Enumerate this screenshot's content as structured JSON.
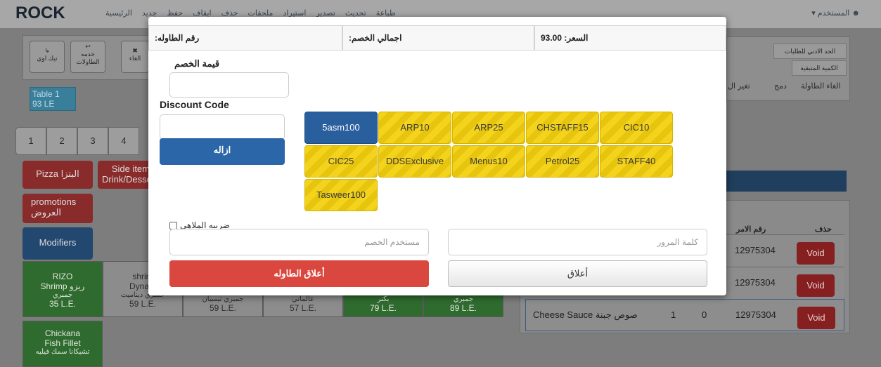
{
  "topbar": {
    "brand": "ROCK",
    "menu": [
      "الرئيسية",
      "جديد",
      "حفظ",
      "ايقاف",
      "حذف",
      "ملحقات",
      "استيراد",
      "تصدير",
      "تحديث",
      "طباعة"
    ],
    "user": "المستخدم"
  },
  "background": {
    "action_buttons": [
      "تيك اوي",
      "خدمه الطاولات",
      "الغاء"
    ],
    "table_card": {
      "name": "Table 1",
      "amount": "93 LE"
    },
    "tabs": [
      "1",
      "2",
      "3",
      "4"
    ],
    "categories": [
      "Pizza البتزا",
      "Side item Drink/Desse",
      "promotions العروض",
      "Modifiers"
    ],
    "right_labels": [
      "الحد الادني للطلبات",
      "الكمية المتبقية"
    ],
    "right_actions": [
      "الغاء الطاولة",
      "دمج",
      "تغير ال"
    ],
    "order_header": {
      "delete": "حذف",
      "order_no": "رقم الامر"
    },
    "orders": [
      {
        "name": "",
        "qty": "",
        "disc": "",
        "no": "12975304",
        "void": "Void"
      },
      {
        "name": "",
        "qty": "",
        "disc": "",
        "no": "12975304",
        "void": "Void"
      },
      {
        "name": "Cheese Sauce صوص جبنة",
        "qty": "1",
        "disc": "0",
        "no": "12975304",
        "void": "Void"
      }
    ],
    "products": [
      {
        "line1": "RIZO",
        "line2": "Shrimp ريزو",
        "line3": "جمبري",
        "price": "35 L.E."
      },
      {
        "line1": "shrim",
        "line2": "Dynam",
        "line3": "جمبري ديناميت",
        "price": "59 L.E."
      },
      {
        "line1": "",
        "line2": "",
        "line3": "جمبري تيمبيان",
        "price": "59 L.E."
      },
      {
        "line1": "",
        "line2": "",
        "line3": "عالماتي",
        "price": "57 L.E."
      },
      {
        "line1": "",
        "line2": "",
        "line3": "بكتر",
        "price": "79 L.E."
      },
      {
        "line1": "",
        "line2": "",
        "line3": "جمبري",
        "price": "89 L.E."
      },
      {
        "line1": "Chickana",
        "line2": "Fish Fillet",
        "line3": "تشيكانا سمك فيليه",
        "price": ""
      }
    ]
  },
  "modal": {
    "header": {
      "table_no": ":رقم الطاوله",
      "total_discount": ":اجمالي الخصم",
      "price": "93.00 :السعر"
    },
    "discount_value_label": "قيمة الخصم",
    "discount_code_label": "Discount Code",
    "remove_button": "ازاله",
    "codes": [
      "5asm100",
      "ARP10",
      "ARP25",
      "CHSTAFF15",
      "CIC10",
      "CIC25",
      "DDSExclusive",
      "Menus10",
      "Petrol25",
      "STAFF40",
      "Tasweer100"
    ],
    "selected_code": "5asm100",
    "entertainment_tax": "ضريبه الملاهى",
    "discount_user_placeholder": "مستخدم الخصم",
    "password_placeholder": "كلمة المرور",
    "close_table_button": "أعلاق الطاوله",
    "close_button": "أعلاق",
    "colors": {
      "primary": "#2b66a8",
      "danger": "#d9473f",
      "code_yellow": "#f3d31c"
    }
  }
}
